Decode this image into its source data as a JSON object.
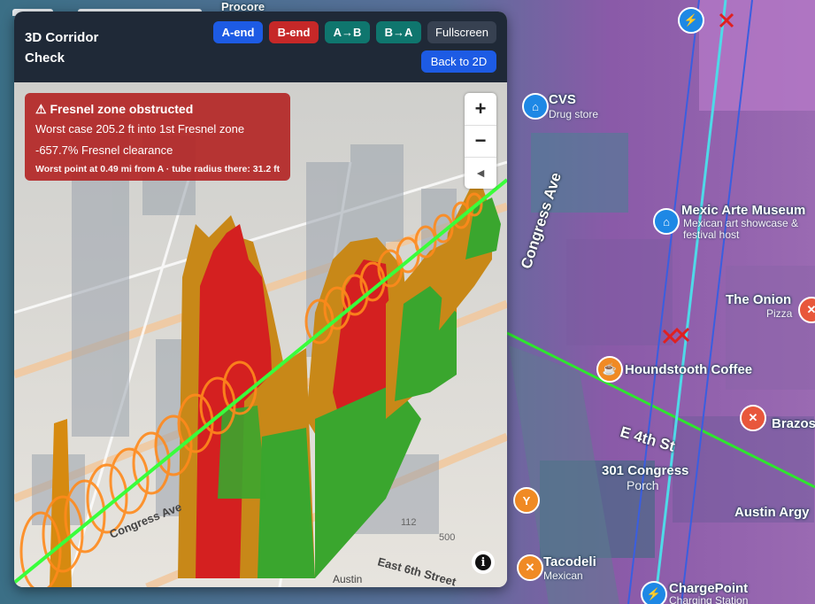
{
  "panel": {
    "title": "3D Corridor Check",
    "buttons": {
      "a_end": "A-end",
      "b_end": "B-end",
      "a_to_b": "A→B",
      "b_to_a": "B→A",
      "fullscreen": "Fullscreen",
      "back_to_2d": "Back to 2D"
    }
  },
  "alert": {
    "title": "⚠ Fresnel zone obstructed",
    "worst_case": "Worst case 205.2 ft into 1st Fresnel zone",
    "clearance": "-657.7% Fresnel clearance",
    "worst_point": "Worst point at 0.49 mi from A · tube radius there: 31.2 ft"
  },
  "nav": {
    "zoom_in": "+",
    "zoom_out": "−",
    "compass": "◄",
    "info": "i"
  },
  "scene_labels": {
    "street_1": "Congress Ave",
    "street_2": "East 6th Street",
    "street_3": "Austin",
    "num_112": "112",
    "num_500": "500"
  },
  "background_map": {
    "street_congress": "Congress Ave",
    "street_e4th": "E 4th St",
    "poi": [
      {
        "name": "CVS",
        "sub": "Drug store",
        "icon": "shopping-bag-icon",
        "color": "#1e88e5"
      },
      {
        "name": "Mexic Arte Museum",
        "sub": "Mexican art showcase & festival host",
        "icon": "museum-icon",
        "color": "#1e88e5"
      },
      {
        "name": "The Onion",
        "sub": "Pizza",
        "icon": "restaurant-icon",
        "color": "#e8573b"
      },
      {
        "name": "Houndstooth Coffee",
        "sub": "",
        "icon": "coffee-icon",
        "color": "#f08a24"
      },
      {
        "name": "301 Congress",
        "sub": "Porch",
        "icon": "cocktail-icon",
        "color": "#f08a24"
      },
      {
        "name": "Austin Argy",
        "sub": "",
        "icon": "pin-icon",
        "color": "#888888"
      },
      {
        "name": "Tacodeli",
        "sub": "Mexican",
        "icon": "restaurant-icon",
        "color": "#f08a24"
      },
      {
        "name": "ChargePoint",
        "sub": "Charging Station",
        "icon": "ev-charger-icon",
        "color": "#1e88e5"
      },
      {
        "name": "Brazos",
        "sub": "",
        "icon": "restaurant-icon",
        "color": "#e8573b"
      },
      {
        "name": "Procore",
        "sub": "",
        "icon": "pin-icon",
        "color": "#888888"
      }
    ]
  },
  "colors": {
    "header_bg": "#1f2937",
    "btn_blue": "#1d5be4",
    "btn_red": "#c62828",
    "btn_teal": "#0f766e",
    "btn_gray": "#374151",
    "alert_red": "#b32626",
    "obstruct_red": "#d42020",
    "obstruct_orange": "#d68a10",
    "clear_green": "#35a82a",
    "fresnel_ring": "#ff8a1c",
    "link_line": "#39ff3b"
  }
}
